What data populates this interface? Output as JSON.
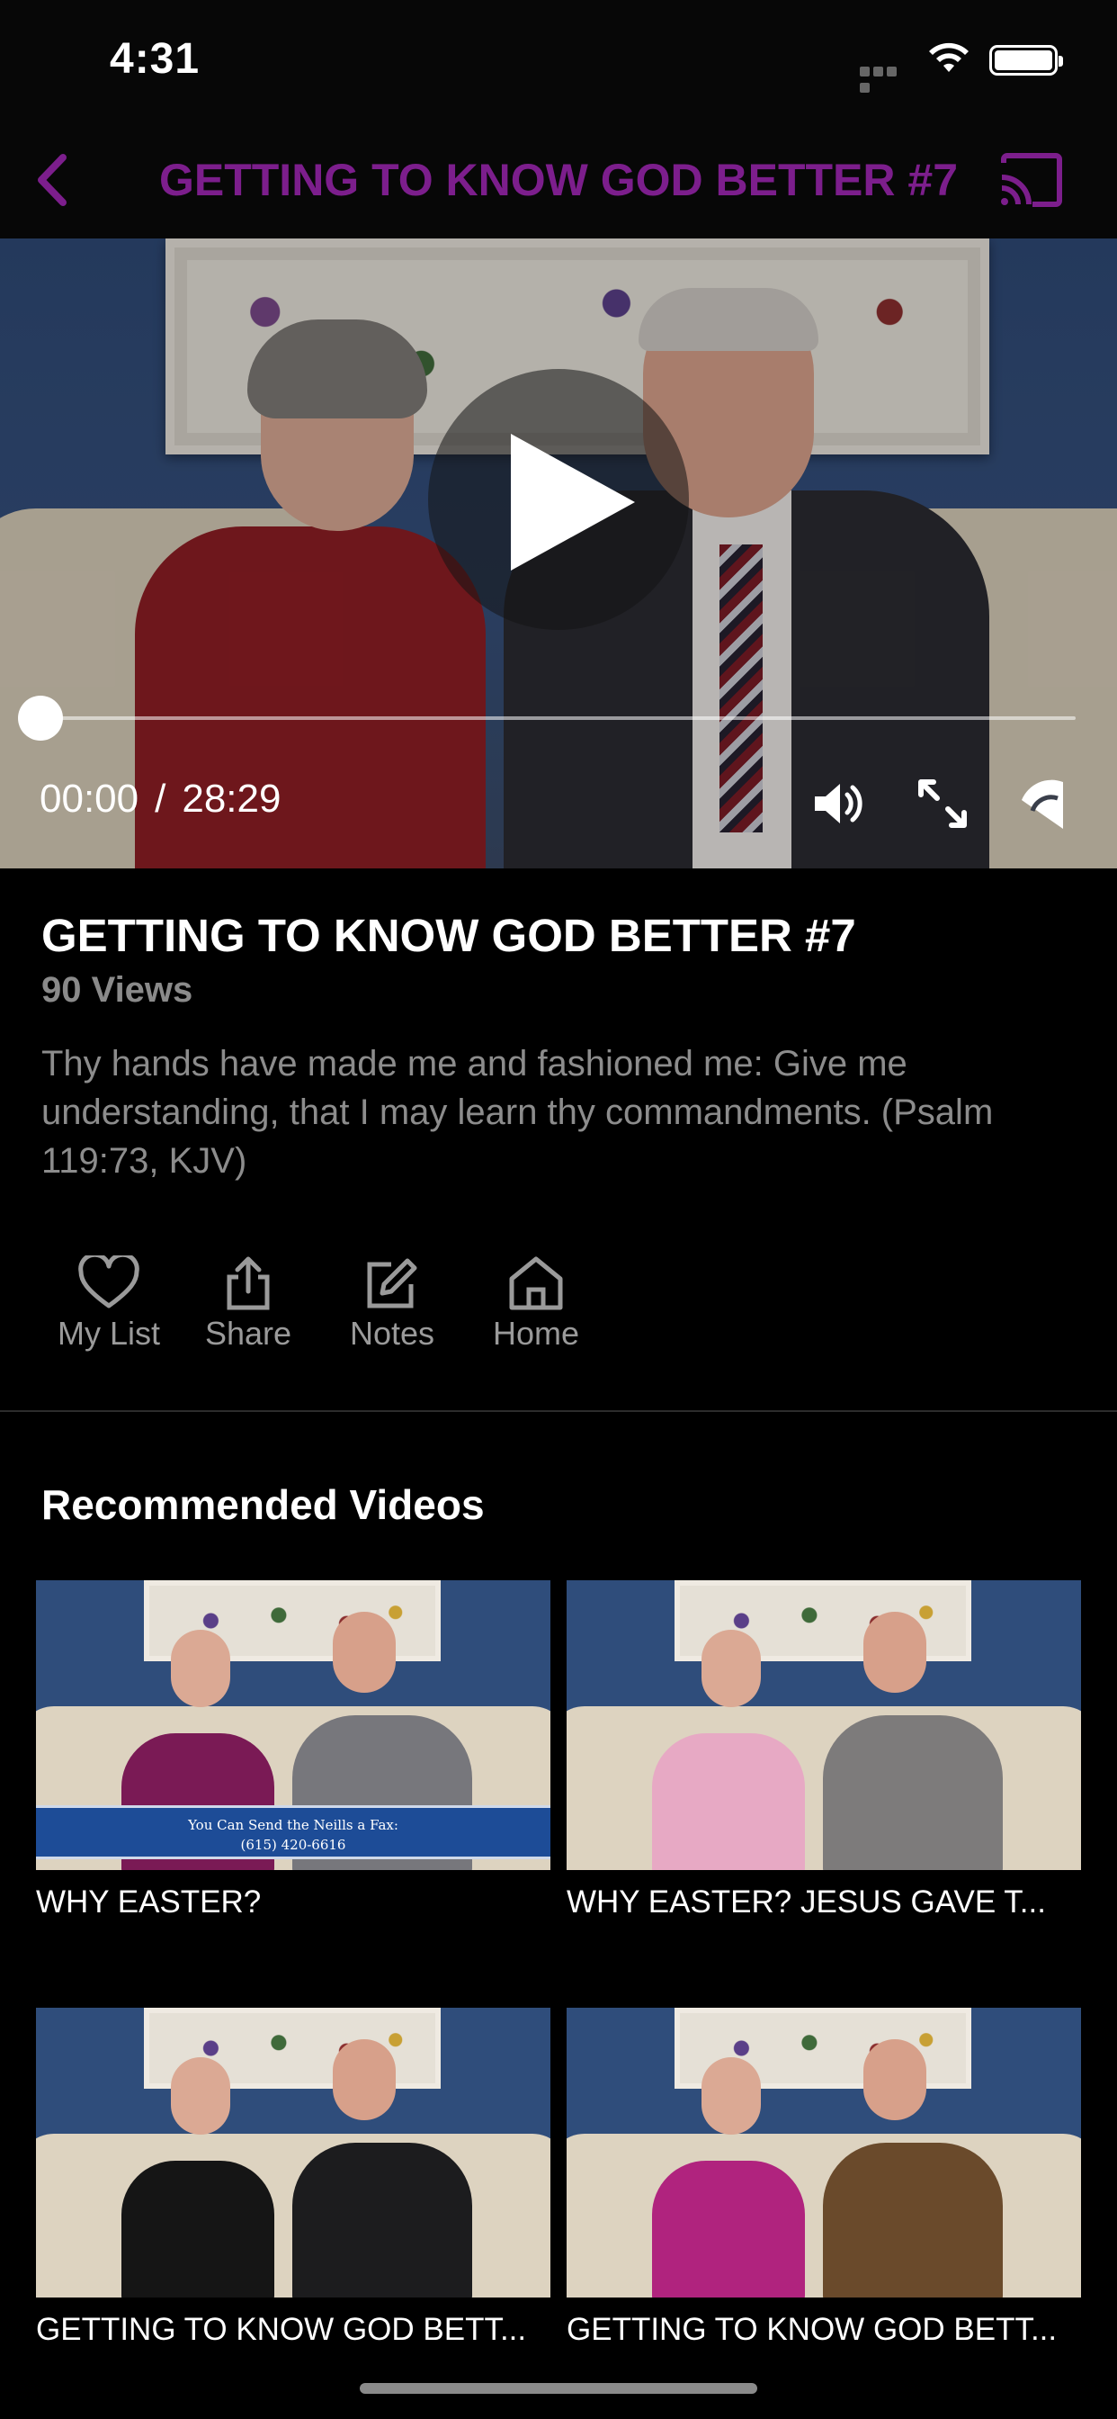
{
  "status_bar": {
    "time": "4:31"
  },
  "nav": {
    "title": "GETTING TO KNOW GOD BETTER #7",
    "accent_color": "#7c1e8c"
  },
  "player": {
    "current_time": "00:00",
    "separator": "/",
    "duration": "28:29",
    "progress_fraction": 0.0,
    "icons": [
      "play-icon",
      "volume-icon",
      "fullscreen-icon",
      "airplay-icon"
    ]
  },
  "video": {
    "title": "GETTING TO KNOW GOD BETTER #7",
    "views": "90 Views",
    "description": "Thy hands have made me and fashioned me:  Give me understanding, that I may learn thy commandments. (Psalm 119:73, KJV)"
  },
  "actions": [
    {
      "label": "My List",
      "icon": "heart-icon"
    },
    {
      "label": "Share",
      "icon": "share-icon"
    },
    {
      "label": "Notes",
      "icon": "edit-icon"
    },
    {
      "label": "Home",
      "icon": "home-icon"
    }
  ],
  "recommended": {
    "heading": "Recommended Videos",
    "items": [
      {
        "title": "WHY EASTER?",
        "banner_line1": "You Can Send the Neills a Fax:",
        "banner_line2": "(615) 420-6616",
        "woman_color": "#7a1a55",
        "man_color": "#77777c"
      },
      {
        "title": "WHY EASTER?  JESUS GAVE T...",
        "woman_color": "#e7a9c4",
        "man_color": "#7d7b7b"
      },
      {
        "title": "GETTING TO KNOW GOD BETT...",
        "woman_color": "#151515",
        "man_color": "#1c1c1e"
      },
      {
        "title": "GETTING TO KNOW GOD BETT...",
        "woman_color": "#b0237e",
        "man_color": "#6a4a2b"
      }
    ]
  }
}
